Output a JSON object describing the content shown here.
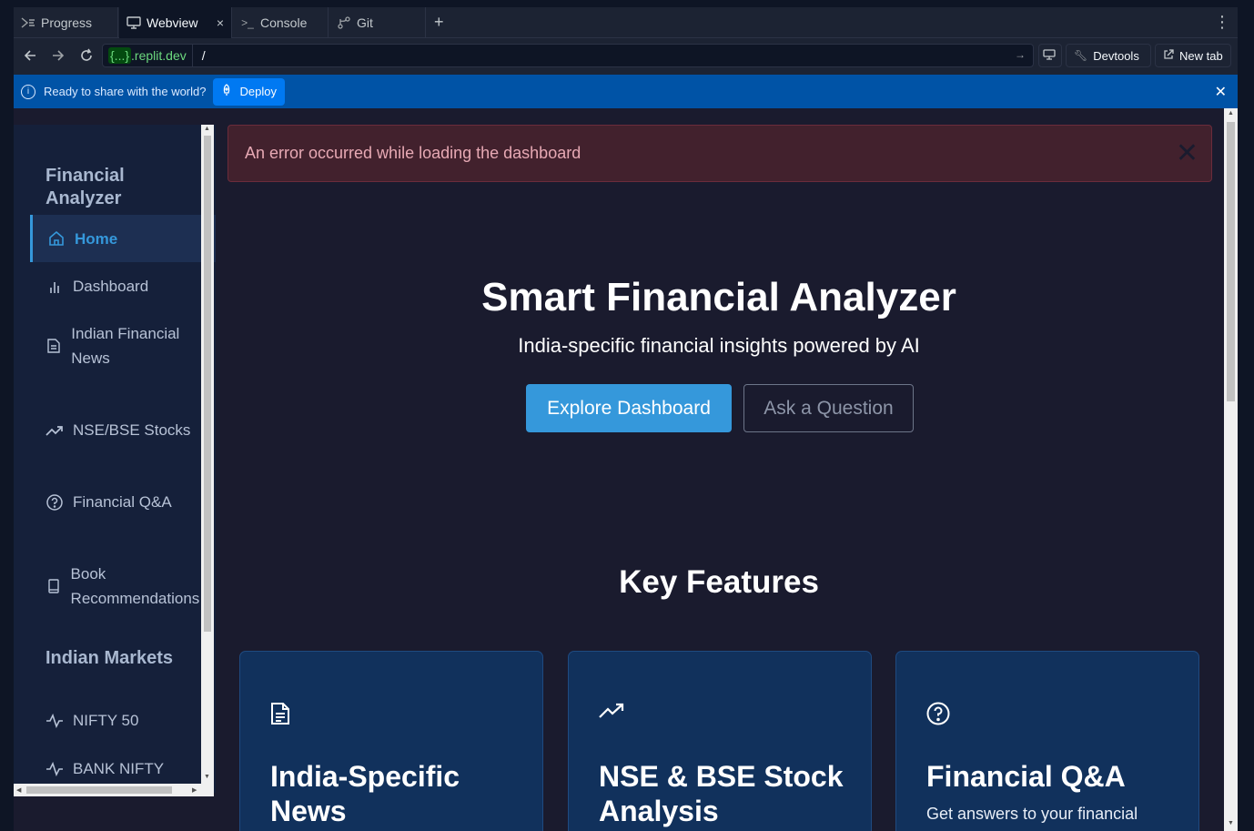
{
  "tabs": [
    {
      "label": "Progress",
      "icon": "progress-icon"
    },
    {
      "label": "Webview",
      "icon": "monitor-icon",
      "active": true
    },
    {
      "label": "Console",
      "icon": "terminal-icon"
    },
    {
      "label": "Git",
      "icon": "git-icon"
    }
  ],
  "url": {
    "host_prefix": "{...}",
    "host_suffix": ".replit.dev",
    "path": "/"
  },
  "toolbar": {
    "devtools": "Devtools",
    "newtab": "New tab"
  },
  "banner": {
    "message": "Ready to share with the world?",
    "deploy": "Deploy"
  },
  "sidebar": {
    "title": "Financial Analyzer",
    "items": [
      {
        "label": "Home",
        "icon": "home-icon"
      },
      {
        "label": "Dashboard",
        "icon": "bar-chart-icon"
      },
      {
        "label": "Indian Financial News",
        "icon": "document-icon"
      },
      {
        "label": "NSE/BSE Stocks",
        "icon": "trending-up-icon"
      },
      {
        "label": "Financial Q&A",
        "icon": "help-circle-icon"
      },
      {
        "label": "Book Recommendations",
        "icon": "book-icon"
      }
    ],
    "section2_title": "Indian Markets",
    "markets": [
      {
        "label": "NIFTY 50",
        "icon": "activity-icon"
      },
      {
        "label": "BANK NIFTY",
        "icon": "activity-icon"
      }
    ]
  },
  "alert": {
    "message": "An error occurred while loading the dashboard"
  },
  "hero": {
    "title": "Smart Financial Analyzer",
    "subtitle": "India-specific financial insights powered by AI",
    "primary_button": "Explore Dashboard",
    "secondary_button": "Ask a Question"
  },
  "features": {
    "heading": "Key Features",
    "cards": [
      {
        "title": "India-Specific News",
        "icon": "document-icon",
        "text": ""
      },
      {
        "title": "NSE & BSE Stock Analysis",
        "icon": "trending-up-icon",
        "text": ""
      },
      {
        "title": "Financial Q&A",
        "icon": "help-circle-icon",
        "text": "Get answers to your financial"
      }
    ]
  }
}
